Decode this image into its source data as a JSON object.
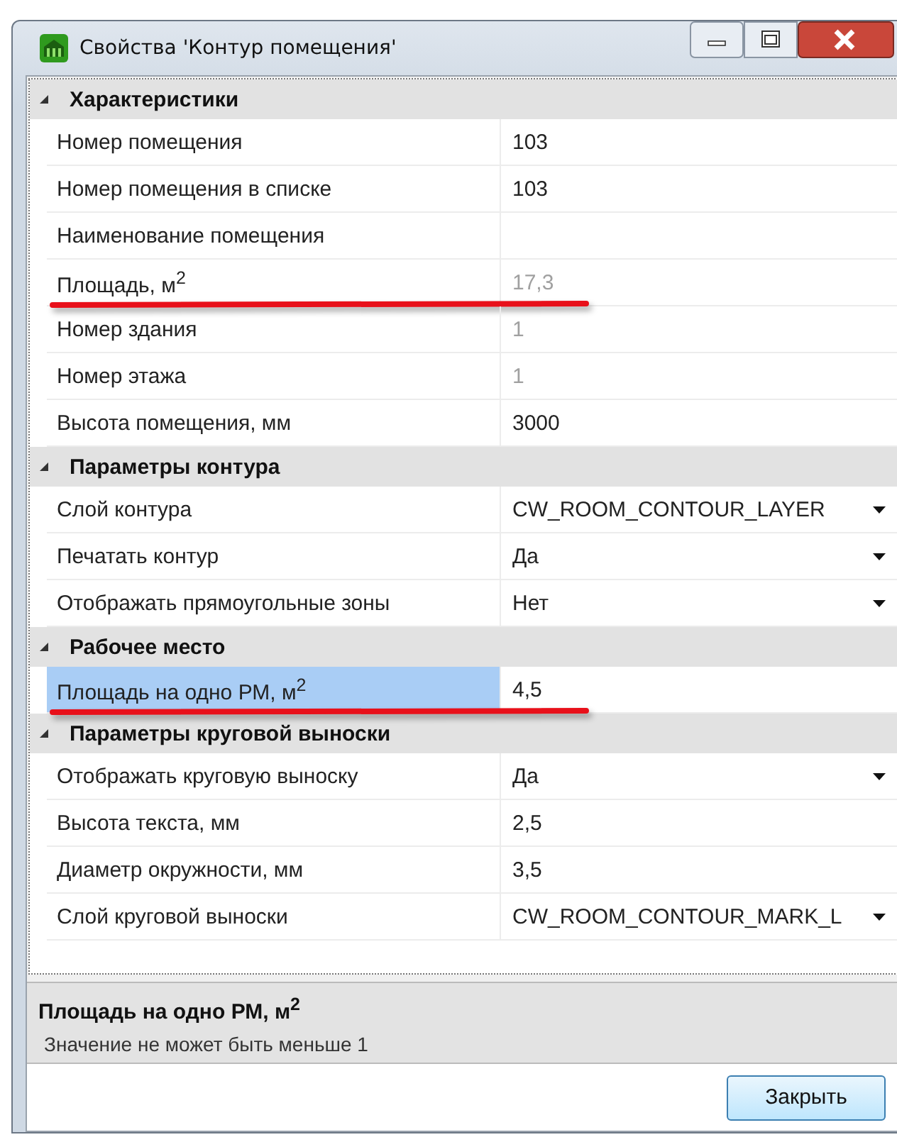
{
  "window": {
    "title": "Свойства 'Контур помещения'"
  },
  "categories": [
    {
      "title": "Характеристики",
      "expanded": true,
      "rows": [
        {
          "label": "Номер помещения",
          "value": "103",
          "kind": "text",
          "selected": false
        },
        {
          "label": "Номер помещения в списке",
          "value": "103",
          "kind": "text",
          "selected": false
        },
        {
          "label": "Наименование помещения",
          "kind": "text",
          "selected": false
        },
        {
          "label": "Площадь, м$^{2}$",
          "value": "17,3",
          "kind": "text",
          "disabled": true,
          "selected": false,
          "underlined": true
        },
        {
          "label": "Номер здания",
          "value": "1",
          "kind": "text",
          "disabled": true,
          "selected": false
        },
        {
          "label": "Номер этажа",
          "value": "1",
          "kind": "text",
          "disabled": true,
          "selected": false
        },
        {
          "label": "Высота помещения, мм",
          "value": "3000",
          "kind": "text",
          "selected": false
        }
      ]
    },
    {
      "title": "Параметры контура",
      "expanded": true,
      "rows": [
        {
          "label": "Слой контура",
          "value": "CW_ROOM_CONTOUR_LAYER",
          "kind": "dropdown",
          "selected": false
        },
        {
          "label": "Печатать контур",
          "value": "Да",
          "kind": "dropdown",
          "selected": false
        },
        {
          "label": "Отображать прямоугольные зоны",
          "value": "Нет",
          "kind": "dropdown",
          "selected": false
        }
      ]
    },
    {
      "title": "Рабочее место",
      "expanded": true,
      "rows": [
        {
          "label": "Площадь на одно РМ, м$^{2}$",
          "value": "4,5",
          "kind": "text",
          "selected": true,
          "underlined": true
        }
      ]
    },
    {
      "title": "Параметры круговой выноски",
      "expanded": true,
      "rows": [
        {
          "label": "Отображать круговую выноску",
          "value": "Да",
          "kind": "dropdown",
          "selected": false
        },
        {
          "label": "Высота текста, мм",
          "value": "2,5",
          "kind": "text",
          "selected": false
        },
        {
          "label": "Диаметр окружности, мм",
          "value": "3,5",
          "kind": "text",
          "selected": false
        },
        {
          "label": "Слой круговой выноски",
          "value": "CW_ROOM_CONTOUR_MARK_L",
          "kind": "dropdown",
          "selected": false
        }
      ]
    }
  ],
  "description": {
    "title": "Площадь на одно РМ, м$^{2}$",
    "text": "Значение не может быть меньше 1"
  },
  "buttons": [
    "Закрыть"
  ]
}
